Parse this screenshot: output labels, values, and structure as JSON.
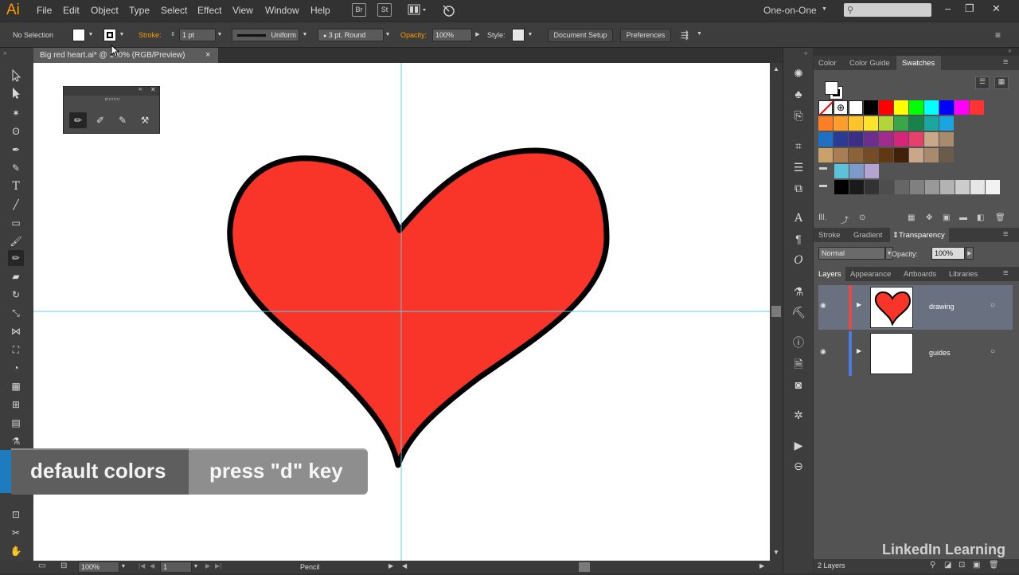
{
  "app": {
    "logo": "Ai"
  },
  "menu": [
    "File",
    "Edit",
    "Object",
    "Type",
    "Select",
    "Effect",
    "View",
    "Window",
    "Help"
  ],
  "menu_buttons": [
    "Br",
    "St"
  ],
  "workspace": "One-on-One",
  "control": {
    "selection": "No Selection",
    "stroke_label": "Stroke:",
    "stroke_value": "1 pt",
    "profile": "Uniform",
    "brush": "3 pt. Round",
    "opacity_label": "Opacity:",
    "opacity_value": "100%",
    "style_label": "Style:",
    "doc_setup": "Document Setup",
    "preferences": "Preferences"
  },
  "document_tab": {
    "title": "Big red heart.ai* @ 100% (RGB/Preview)",
    "close": "×"
  },
  "status": {
    "zoom": "100%",
    "artboard": "1",
    "tool": "Pencil"
  },
  "panels": {
    "color_tabs": [
      "Color",
      "Color Guide",
      "Swatches"
    ],
    "active_color_tab": "Swatches",
    "mid_tabs": [
      "Stroke",
      "Gradient",
      "Transparency"
    ],
    "blend_mode": "Normal",
    "opacity_label": "Opacity:",
    "opacity_value": "100%",
    "layer_tabs": [
      "Layers",
      "Appearance",
      "Artboards",
      "Libraries"
    ],
    "layers": [
      {
        "name": "drawing",
        "color": "#e34b4b"
      },
      {
        "name": "guides",
        "color": "#4a7be0"
      }
    ],
    "layers_count": "2 Layers"
  },
  "swatches": [
    [
      "#ffffff",
      "#000000",
      "#ff0000",
      "#ffff00",
      "#00ff00",
      "#00ffff",
      "#0000ff",
      "#ff00ff",
      "#ff3333"
    ],
    [
      "#ff7f27",
      "#ff9e2a",
      "#ffc32b",
      "#ffe42a",
      "#b5d33a",
      "#3aa64a",
      "#17824b",
      "#19a7a0",
      "#1aa5e0"
    ],
    [
      "#1f6fc3",
      "#2b3b93",
      "#3b2e85",
      "#6d2e8e",
      "#a02c8c",
      "#d6267a",
      "#e6406c",
      "#c9a789",
      "#a88b6d"
    ],
    [
      "#c9a16d",
      "#a97e54",
      "#8c6239",
      "#754c24",
      "#603813",
      "#42210b",
      "#c9a789",
      "#a88b6d",
      "#6b5b4b"
    ],
    [
      "#5fc1d9",
      "#7f99c8",
      "#b5a3d1"
    ],
    [
      "#000000",
      "#1a1a1a",
      "#333333",
      "#4d4d4d",
      "#666666",
      "#808080",
      "#999999",
      "#b3b3b3",
      "#cccccc",
      "#e6e6e6",
      "#f2f2f2"
    ]
  ],
  "lower_third": {
    "left": "default colors",
    "right": "press \"d\" key"
  },
  "watermark": "LinkedIn Learning"
}
